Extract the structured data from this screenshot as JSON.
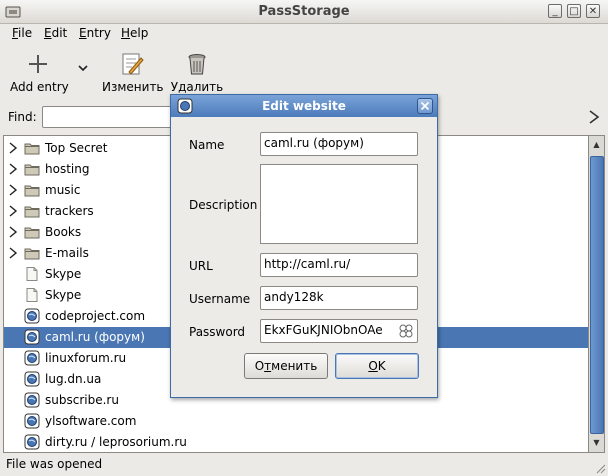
{
  "window": {
    "title": "PassStorage",
    "controls": {
      "minimize": "_",
      "maximize": "□",
      "close": "✕"
    }
  },
  "menu": {
    "file": {
      "mnemonic": "F",
      "rest": "ile"
    },
    "edit": {
      "mnemonic": "E",
      "rest": "dit"
    },
    "entry": {
      "mnemonic": "E",
      "rest": "ntry"
    },
    "help": {
      "mnemonic": "H",
      "rest": "elp"
    }
  },
  "toolbar": {
    "add_label": "Add entry",
    "edit_label": "Изменить",
    "delete_label": "Удалить"
  },
  "find": {
    "label": "Find:",
    "value": ""
  },
  "tree": {
    "rows": [
      {
        "label": "Top Secret",
        "icon": "folder-icon",
        "expandable": true
      },
      {
        "label": "hosting",
        "icon": "folder-icon",
        "expandable": true
      },
      {
        "label": "music",
        "icon": "folder-icon",
        "expandable": true
      },
      {
        "label": "trackers",
        "icon": "folder-icon",
        "expandable": true
      },
      {
        "label": "Books",
        "icon": "folder-icon",
        "expandable": true
      },
      {
        "label": "E-mails",
        "icon": "folder-icon",
        "expandable": true
      },
      {
        "label": "Skype",
        "icon": "document-icon",
        "expandable": false
      },
      {
        "label": "Skype",
        "icon": "document-icon",
        "expandable": false
      },
      {
        "label": "codeproject.com",
        "icon": "globe-icon",
        "expandable": false
      },
      {
        "label": "caml.ru (форум)",
        "icon": "globe-icon",
        "expandable": false,
        "selected": true
      },
      {
        "label": "linuxforum.ru",
        "icon": "globe-icon",
        "expandable": false
      },
      {
        "label": "lug.dn.ua",
        "icon": "globe-icon",
        "expandable": false
      },
      {
        "label": "subscribe.ru",
        "icon": "globe-icon",
        "expandable": false
      },
      {
        "label": "ylsoftware.com",
        "icon": "globe-icon",
        "expandable": false
      },
      {
        "label": "dirty.ru / leprosorium.ru",
        "icon": "globe-icon",
        "expandable": false
      }
    ]
  },
  "status": {
    "text": "File was opened"
  },
  "dialog": {
    "title": "Edit website",
    "fields": {
      "name": {
        "label": "Name",
        "value": "caml.ru (форум)"
      },
      "description": {
        "label": "Description",
        "value": ""
      },
      "url": {
        "label": "URL",
        "value": "http://caml.ru/"
      },
      "username": {
        "label": "Username",
        "value": "andy128k"
      },
      "password": {
        "label": "Password",
        "value": "EkxFGuKJNIObnOAe"
      }
    },
    "cancel": {
      "pre": "О",
      "mnemonic": "т",
      "post": "менить"
    },
    "ok": {
      "mnemonic": "O",
      "rest": "K"
    }
  },
  "colors": {
    "selection": "#4a77b4",
    "dialog_title": "#5a86c3"
  }
}
